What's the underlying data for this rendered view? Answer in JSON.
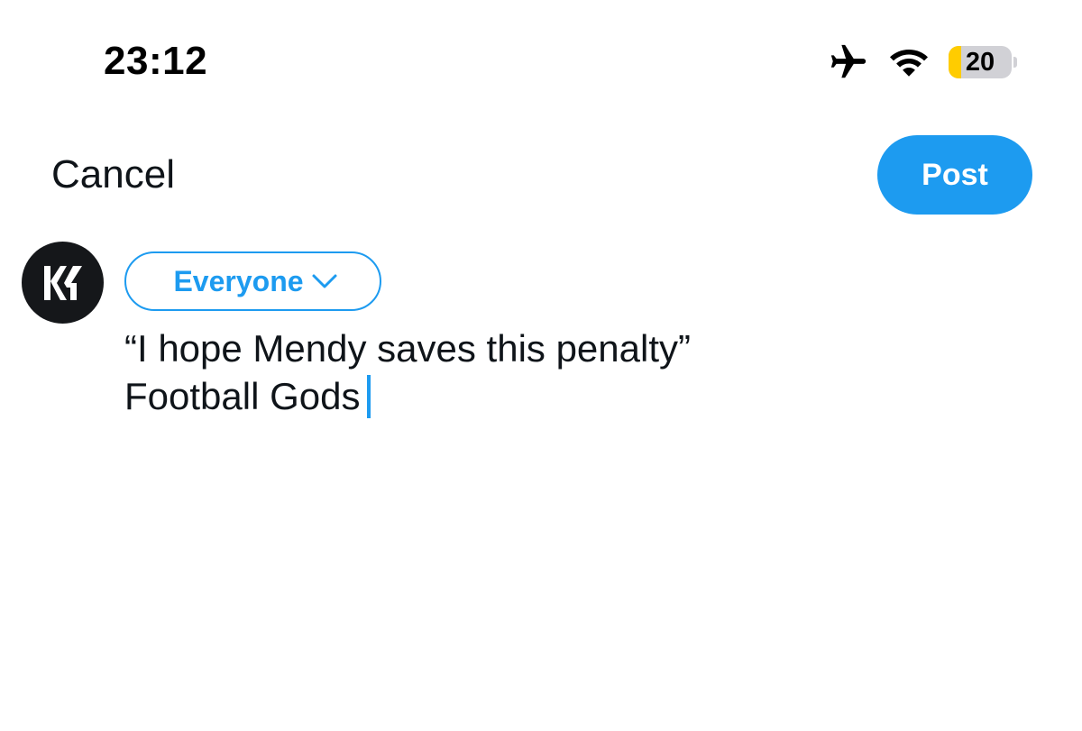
{
  "status_bar": {
    "time": "23:12",
    "icons": [
      "airplane-icon",
      "wifi-icon",
      "battery-icon"
    ],
    "battery_level": "20",
    "battery_fraction": 0.2,
    "battery_fill_color": "#ffcc00"
  },
  "toolbar": {
    "cancel_label": "Cancel",
    "post_label": "Post",
    "accent_color": "#1d9bf0"
  },
  "composer": {
    "audience_label": "Everyone",
    "audience_icon": "chevron-down-icon",
    "avatar_icon": "kf-logo-avatar",
    "text_lines": [
      "“I hope Mendy saves this penalty”",
      "Football Gods"
    ]
  }
}
